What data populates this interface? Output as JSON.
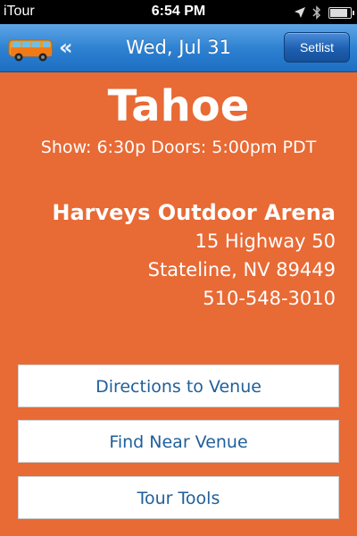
{
  "status_bar": {
    "carrier": "iTour",
    "time": "6:54 PM",
    "location_icon": "location-arrow-icon",
    "bluetooth_icon": "bluetooth-icon",
    "battery_level": 0.85
  },
  "nav": {
    "logo_icon": "van-icon",
    "back_icon": "double-chevron-left-icon",
    "back_glyph": "«",
    "title": "Wed, Jul 31",
    "setlist_label": "Setlist"
  },
  "show": {
    "city": "Tahoe",
    "times": "Show: 6:30p Doors: 5:00pm PDT"
  },
  "venue": {
    "name": "Harveys Outdoor Arena",
    "address_line1": "15 Highway 50",
    "address_line2": "Stateline, NV 89449",
    "phone": "510-548-3010"
  },
  "actions": [
    {
      "label": "Directions to Venue"
    },
    {
      "label": "Find Near Venue"
    },
    {
      "label": "Tour Tools"
    }
  ],
  "colors": {
    "background": "#e86a35",
    "nav_bar": "#2f82d2",
    "button_text": "#1f5f9a"
  }
}
